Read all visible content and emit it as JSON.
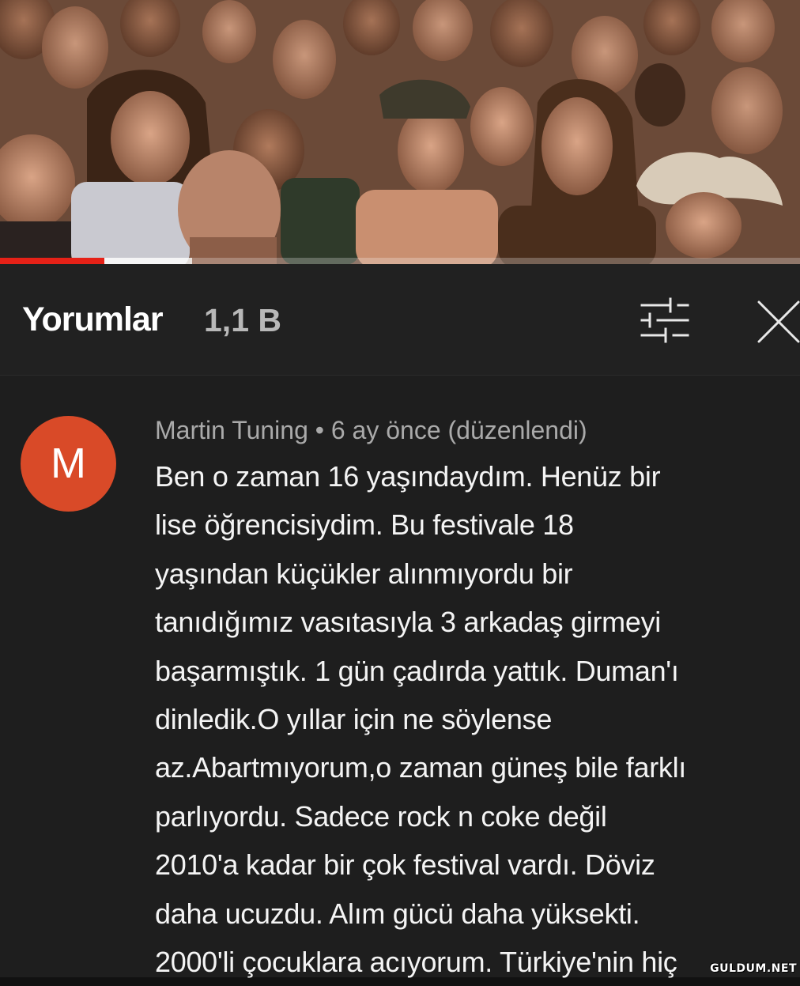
{
  "video": {
    "played_fraction": 0.13,
    "buffered_fraction": 0.24
  },
  "comments_header": {
    "title": "Yorumlar",
    "count": "1,1 B",
    "filter_icon": "sliders-filter-icon",
    "close_icon": "close-icon"
  },
  "comment": {
    "avatar_letter": "M",
    "avatar_color": "#d94a28",
    "author": "Martin Tuning",
    "separator": "•",
    "time": "6 ay önce (düzenlendi)",
    "lines": [
      "Ben o zaman 16 yaşındaydım. Henüz bir",
      "lise öğrencisiydim. Bu festivale 18",
      "yaşından küçükler alınmıyordu bir",
      "tanıdığımız vasıtasıyla 3 arkadaş girmeyi",
      "başarmıştık. 1 gün çadırda yattık. Duman'ı",
      "dinledik.O yıllar için ne söylense",
      "az.Abartmıyorum,o zaman güneş bile farklı",
      "parlıyordu. Sadece rock n coke değil",
      "2010'a kadar bir çok festival vardı. Döviz",
      "daha ucuzdu. Alım gücü daha yüksekti.",
      "2000'li çocuklara acıyorum. Türkiye'nin hiç"
    ]
  },
  "watermark": "GULDUM.NET",
  "colors": {
    "accent_red": "#e62117",
    "panel_bg": "#1e1e1e",
    "meta_gray": "#aaaaaa"
  }
}
